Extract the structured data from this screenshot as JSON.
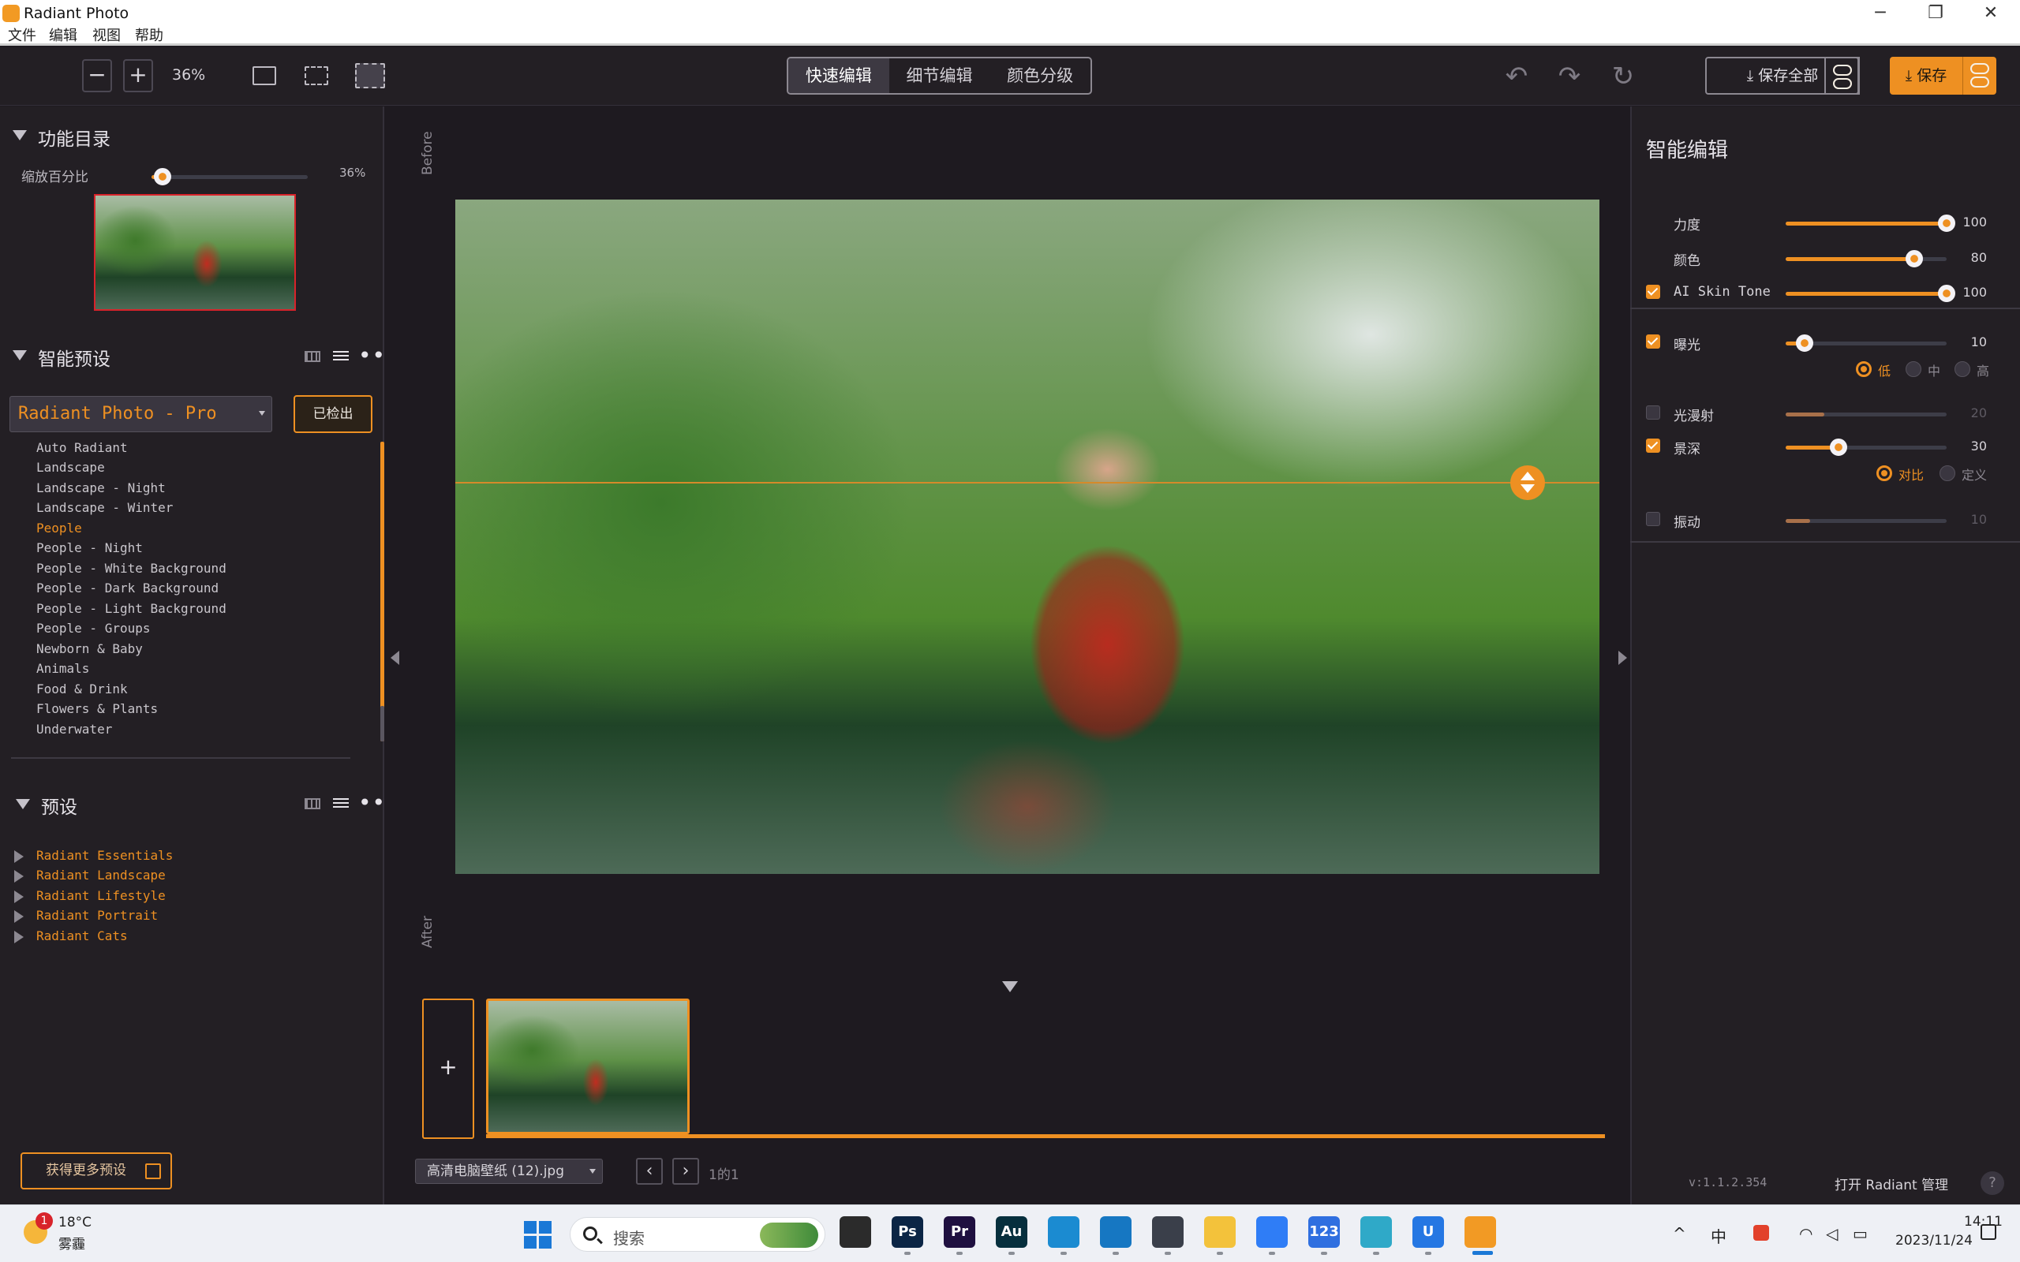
{
  "window": {
    "title": "Radiant Photo",
    "minimize": "─",
    "maximize": "❐",
    "close": "✕"
  },
  "menu": [
    "文件",
    "编辑",
    "视图",
    "帮助"
  ],
  "toolbar": {
    "zoom_out": "−",
    "zoom_in": "+",
    "zoom_value": "36%",
    "modes": [
      "快速编辑",
      "细节编辑",
      "颜色分级"
    ],
    "active_mode": 0,
    "undo_icon": "↶",
    "redo_icon": "↷",
    "reset_icon": "↻",
    "save_all": "保存全部",
    "save": "保存"
  },
  "left_panel": {
    "navigator": {
      "title": "功能目录",
      "zoom_label": "缩放百分比",
      "zoom_value": "36%",
      "zoom_fraction": 0.07
    },
    "smart_presets": {
      "title": "智能预设",
      "selected": "Radiant Photo - Pro",
      "checked_out_button": "已检出",
      "items": [
        "Auto Radiant",
        "Landscape",
        "Landscape - Night",
        "Landscape - Winter",
        "People",
        "People - Night",
        "People - White Background",
        "People - Dark Background",
        "People - Light Background",
        "People - Groups",
        "Newborn & Baby",
        "Animals",
        "Food & Drink",
        "Flowers & Plants",
        "Underwater"
      ],
      "active_index": 4
    },
    "presets": {
      "title": "预设",
      "categories": [
        "Radiant Essentials",
        "Radiant Landscape",
        "Radiant Lifestyle",
        "Radiant Portrait",
        "Radiant Cats"
      ]
    },
    "get_more_presets": "获得更多预设"
  },
  "canvas": {
    "before_label": "Before",
    "after_label": "After",
    "add_photo": "+",
    "file_name": "高清电脑壁纸 (12).jpg",
    "prev": "‹",
    "next": "›",
    "page_text": "1的1"
  },
  "right_panel": {
    "title": "智能编辑",
    "sliders": [
      {
        "label": "力度",
        "value": "100",
        "fraction": 1.0,
        "checkbox": null
      },
      {
        "label": "颜色",
        "value": "80",
        "fraction": 0.8,
        "checkbox": null
      },
      {
        "label": "AI Skin Tone",
        "value": "100",
        "fraction": 1.0,
        "checkbox": true
      },
      {
        "label": "曝光",
        "value": "10",
        "fraction": 0.12,
        "checkbox": true
      },
      {
        "label": "光漫射",
        "value": "20",
        "fraction": 0.24,
        "checkbox": false
      },
      {
        "label": "景深",
        "value": "30",
        "fraction": 0.33,
        "checkbox": true
      },
      {
        "label": "振动",
        "value": "10",
        "fraction": 0.15,
        "checkbox": false
      }
    ],
    "exposure_options": [
      "低",
      "中",
      "高"
    ],
    "exposure_selected": 0,
    "depth_options": [
      "对比",
      "定义"
    ],
    "depth_selected": 0,
    "version": "v:1.1.2.354",
    "open_manager": "打开 Radiant 管理",
    "help": "?"
  },
  "taskbar": {
    "weather_badge": "1",
    "temperature": "18°C",
    "weather": "雾霾",
    "search_placeholder": "搜索",
    "apps": [
      {
        "name": "task-view",
        "label": "",
        "color": "#2b2b2b"
      },
      {
        "name": "photoshop",
        "label": "Ps",
        "color": "#0b2545"
      },
      {
        "name": "premiere",
        "label": "Pr",
        "color": "#1f1040"
      },
      {
        "name": "audition",
        "label": "Au",
        "color": "#062f3d"
      },
      {
        "name": "edge",
        "label": "",
        "color": "#1b8bd1"
      },
      {
        "name": "edge-beta",
        "label": "",
        "color": "#1677c2"
      },
      {
        "name": "unity",
        "label": "",
        "color": "#3a3f4a"
      },
      {
        "name": "file-explorer",
        "label": "",
        "color": "#f3c23b"
      },
      {
        "name": "feishu",
        "label": "",
        "color": "#2f7df6"
      },
      {
        "name": "123pan",
        "label": "123",
        "color": "#2f6fe0"
      },
      {
        "name": "app-photo",
        "label": "",
        "color": "#2fa9c8"
      },
      {
        "name": "uu",
        "label": "U",
        "color": "#2577e3"
      },
      {
        "name": "radiant-photo",
        "label": "",
        "color": "#f29a24"
      }
    ],
    "tray": {
      "chevron": "^",
      "ime": "中",
      "time": "14:11",
      "date": "2023/11/24"
    }
  }
}
